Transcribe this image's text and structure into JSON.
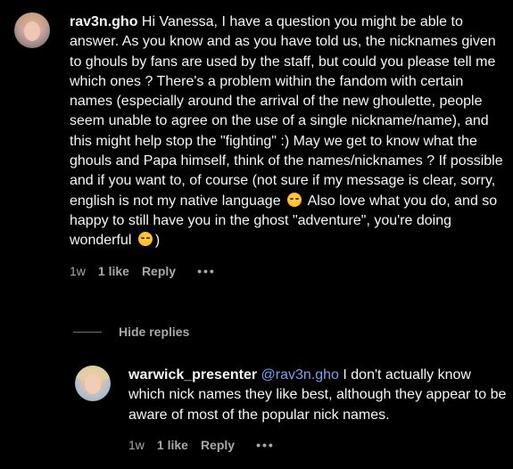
{
  "top_comment": {
    "username": "rav3n.gho",
    "text_part1": "Hi Vanessa, I have a question you might be able to answer. As you know and as you have told us, the nicknames given to ghouls by fans are used by the staff, but could you please tell me which ones ? There's a problem within the fandom with certain names (especially around the arrival of the new ghoulette, people seem unable to agree on the use of a single nickname/name), and this might help stop the \"fighting\" :) May we get to know what the ghouls and Papa himself, think of the names/nicknames ? If possible and if you want to, of course (not sure if my message is clear, sorry, english is not my native language",
    "text_part2": "Also love what you do, and so happy to still have you in the ghost \"adventure\", you're doing wonderful",
    "text_part3": ")",
    "emoji1": "smiling-face-with-hearts-emoji",
    "emoji2": "smiling-face-emoji",
    "time": "1w",
    "likes": "1 like",
    "reply_label": "Reply",
    "more": "•••"
  },
  "hide_replies_label": "Hide replies",
  "reply_comment": {
    "username": "warwick_presenter",
    "mention": "@rav3n.gho",
    "text": "I don't actually know which nick names they like best, although they appear to be aware of most of the popular nick names.",
    "time": "1w",
    "likes": "1 like",
    "reply_label": "Reply",
    "more": "•••"
  },
  "colors": {
    "background": "#000000",
    "text": "#f5f5f5",
    "secondary": "#a8a8a8",
    "mention": "#7a9ff0"
  }
}
